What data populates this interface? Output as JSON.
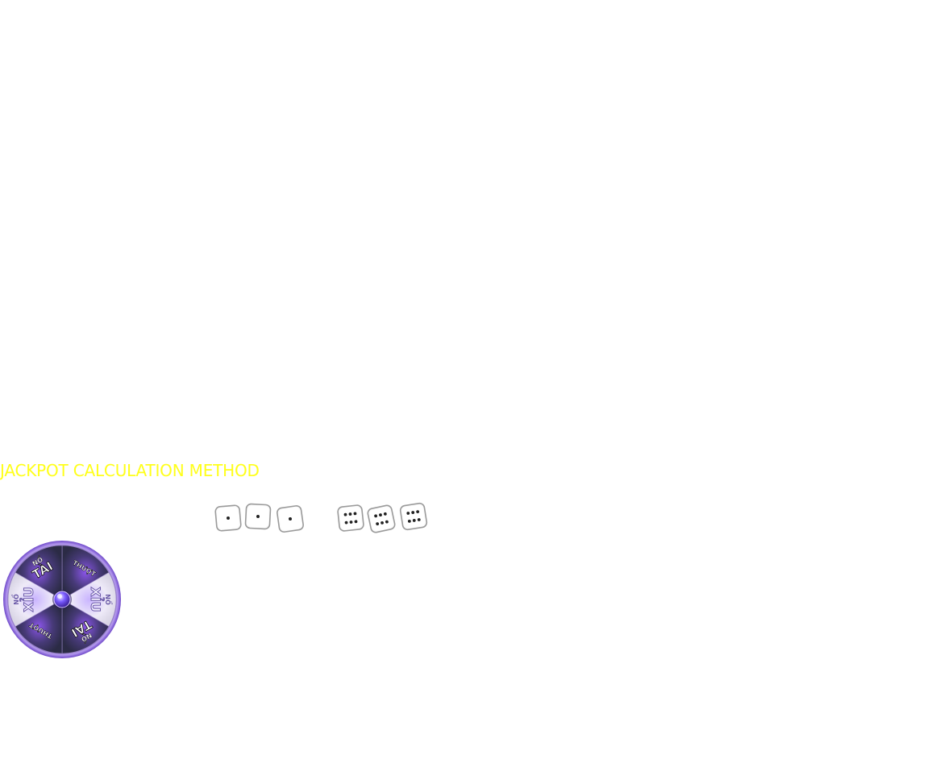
{
  "jackpot": {
    "title": "JACKPOT CALCULATION METHOD",
    "title_color": "#ffff1a"
  },
  "dice": {
    "low_set": [
      1,
      1,
      1
    ],
    "high_set": [
      6,
      6,
      6
    ]
  },
  "wheel": {
    "segments": [
      {
        "top": "NỔ",
        "main": "TÀI",
        "tone": "dark"
      },
      {
        "top": "",
        "main": "THƯỢT",
        "tone": "dark"
      },
      {
        "top": "NỔ",
        "main": "XỈU",
        "tone": "light"
      },
      {
        "top": "NỔ",
        "main": "TÀI",
        "tone": "dark"
      },
      {
        "top": "",
        "main": "THƯỢT",
        "tone": "dark"
      },
      {
        "top": "NỔ",
        "main": "XỈU",
        "tone": "light"
      }
    ],
    "rim_color": "#8a5cd6",
    "hub_color": "#6a4bff"
  }
}
